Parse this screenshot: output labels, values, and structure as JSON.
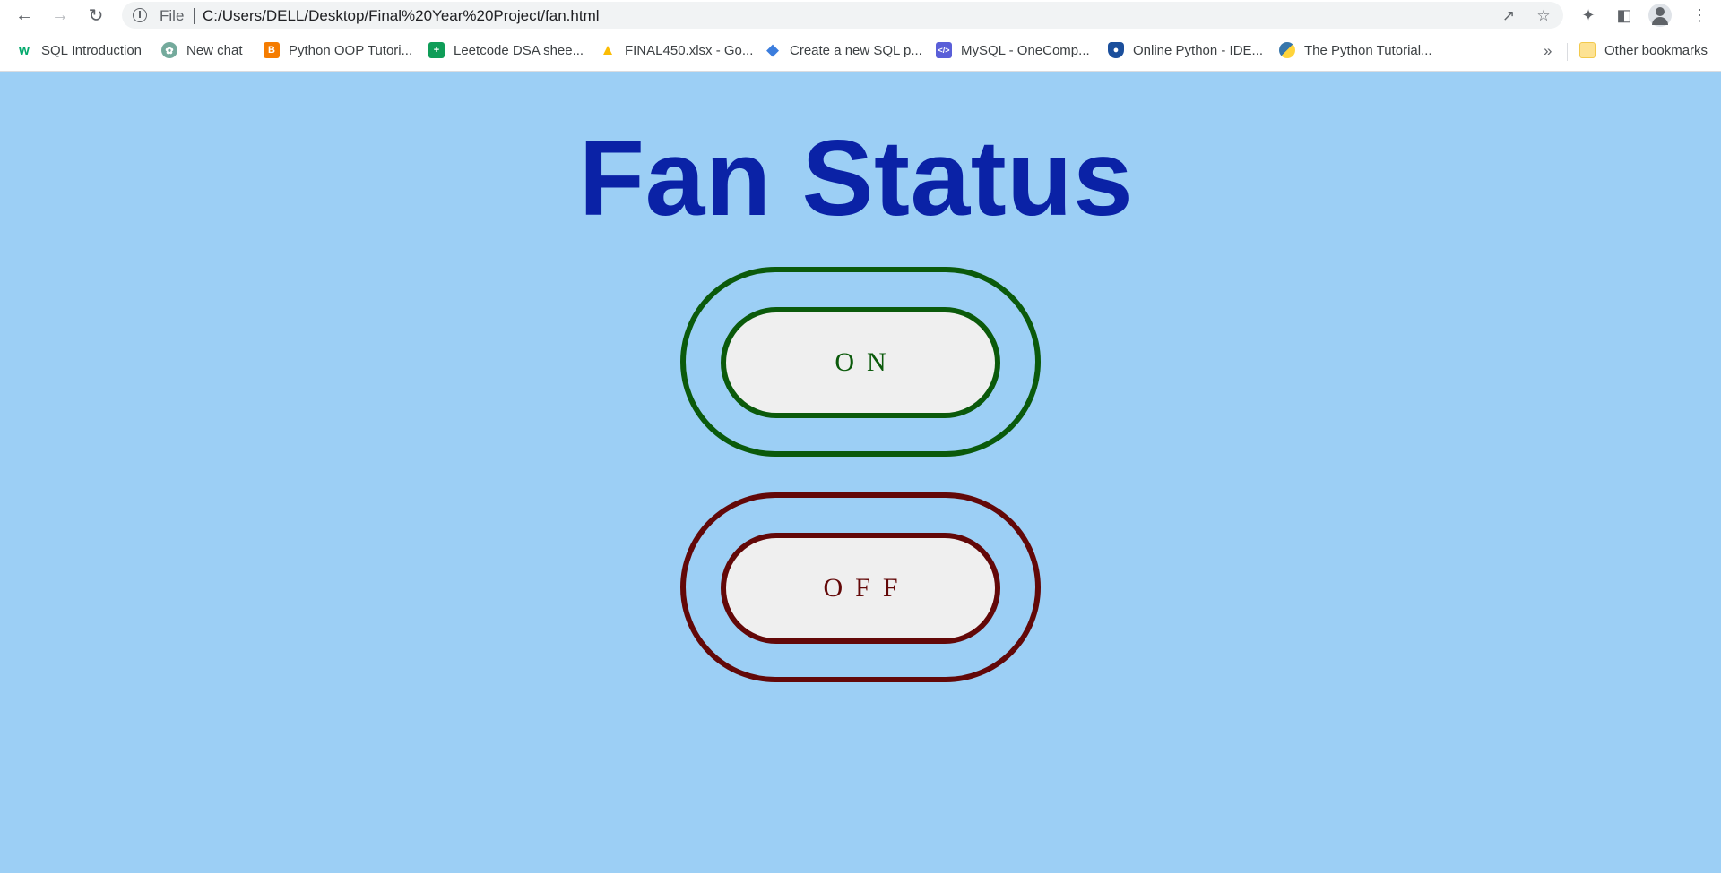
{
  "browser": {
    "file_label": "File",
    "url": "C:/Users/DELL/Desktop/Final%20Year%20Project/fan.html",
    "bookmarks": [
      {
        "label": "SQL Introduction",
        "icon": "w3schools-icon",
        "color": "#04aa6d"
      },
      {
        "label": "New chat",
        "icon": "chatgpt-icon",
        "color": "#74aa9c"
      },
      {
        "label": "Python OOP Tutori...",
        "icon": "blogger-icon",
        "color": "#f57c00"
      },
      {
        "label": "Leetcode DSA shee...",
        "icon": "google-sheets-icon",
        "color": "#0f9d58"
      },
      {
        "label": "FINAL450.xlsx - Go...",
        "icon": "google-drive-icon",
        "color": "#fbbc04"
      },
      {
        "label": "Create a new SQL p...",
        "icon": "diamond-icon",
        "color": "#3b7ddd"
      },
      {
        "label": "MySQL - OneComp...",
        "icon": "code-icon",
        "color": "#5a5fd8"
      },
      {
        "label": "Online Python - IDE...",
        "icon": "shield-icon",
        "color": "#1b4f9c"
      },
      {
        "label": "The Python Tutorial...",
        "icon": "python-icon",
        "color": "#3776ab"
      }
    ],
    "more_label": "»",
    "other_bookmarks": "Other bookmarks"
  },
  "page": {
    "title": "Fan Status",
    "on_label": "ON",
    "off_label": "OFF",
    "colors": {
      "background": "#9ccff5",
      "title": "#0a22a6",
      "on": "#0b5a0b",
      "off": "#630808"
    }
  }
}
